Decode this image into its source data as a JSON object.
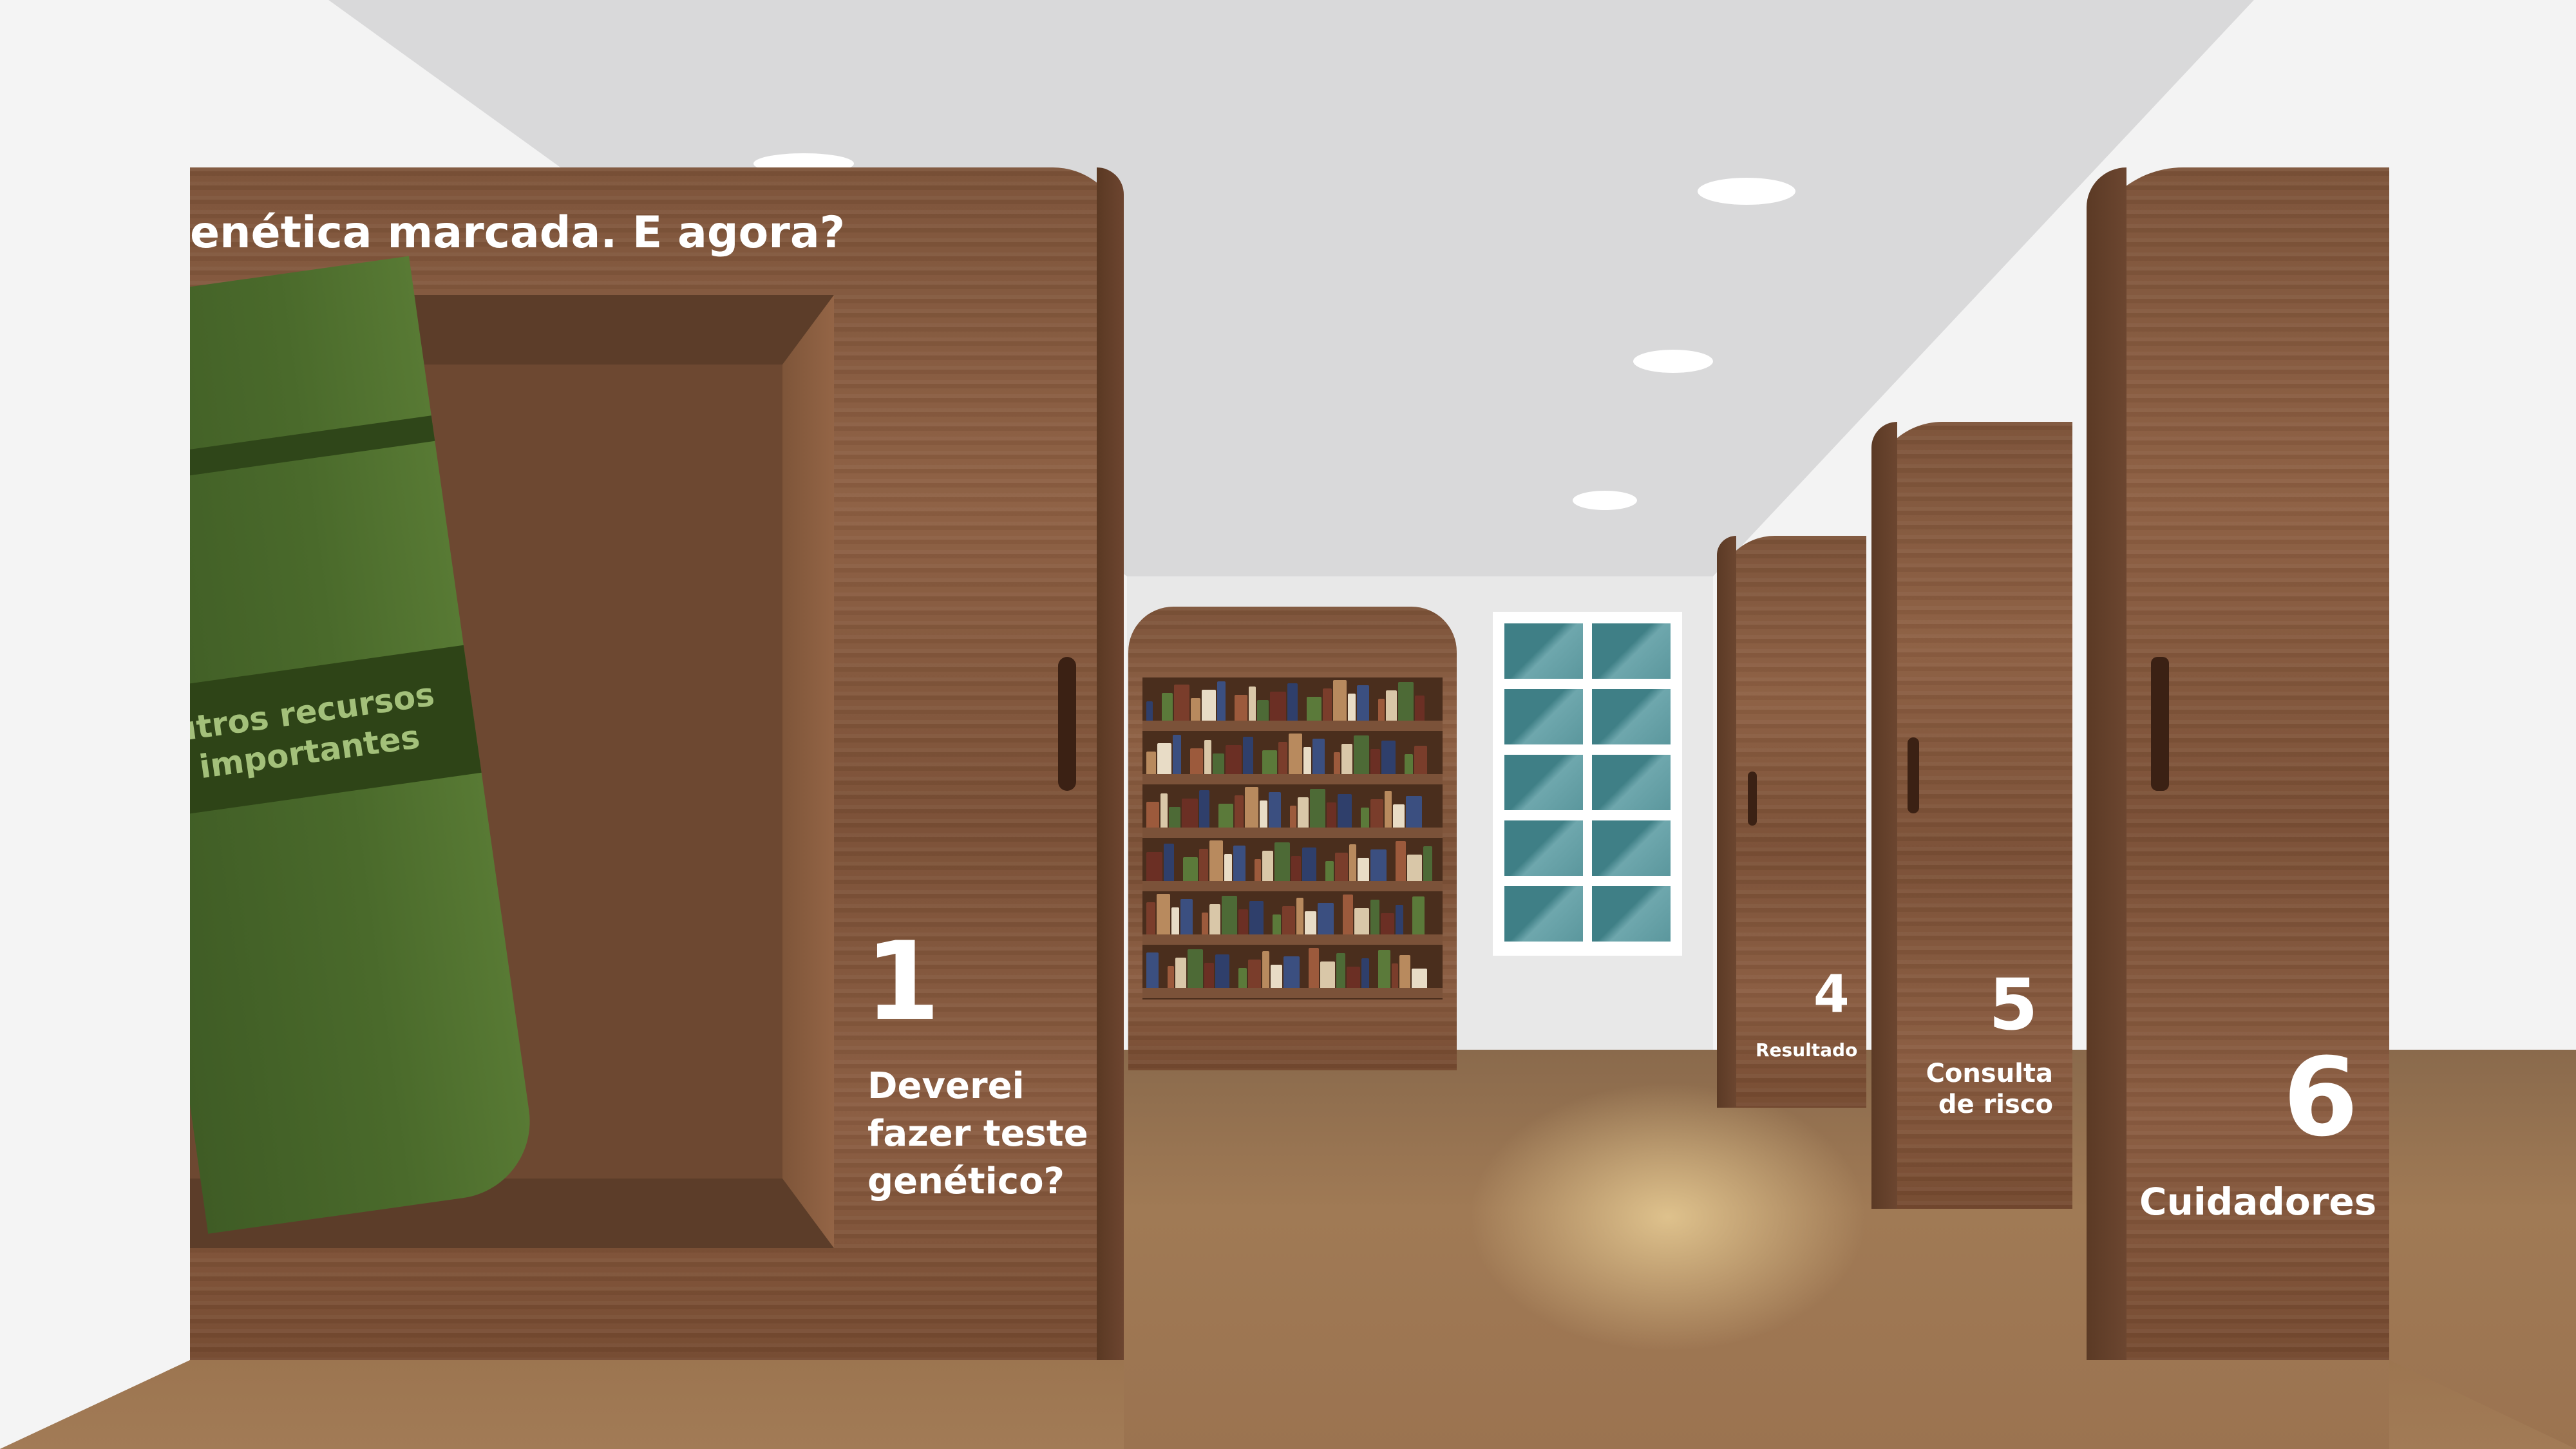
{
  "scene": {
    "title_fragment": "enética marcada. E agora?",
    "binder_label": "utros recursos\nimportantes",
    "door1": {
      "number": "1",
      "label": "Deverei fazer teste genético?"
    },
    "door4": {
      "number": "4",
      "label": "Resultado"
    },
    "door5": {
      "number": "5",
      "label": "Consulta de risco"
    },
    "door6": {
      "number": "6",
      "label": "Cuidadores"
    }
  },
  "colors": {
    "wall": "#f4f4f4",
    "ceiling": "#d8d8d8",
    "wood": "#8a5c40",
    "binder_green": "#4a6a2b",
    "window_glass": "#3f7f86",
    "floor": "#a07a55"
  }
}
